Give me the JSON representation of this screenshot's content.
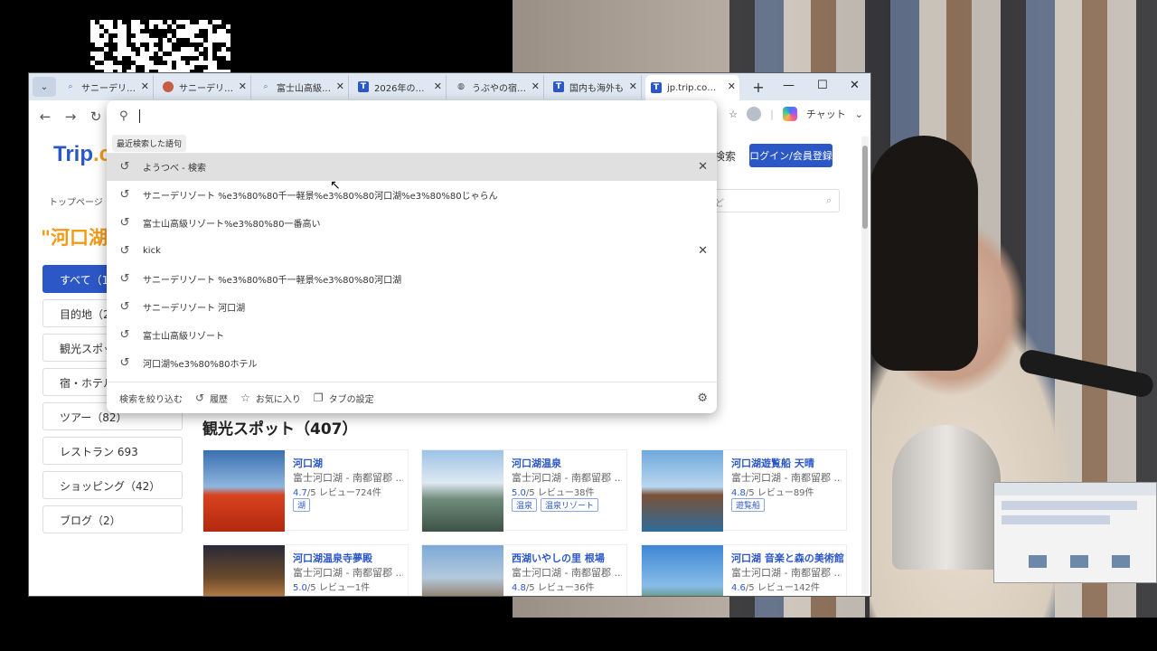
{
  "browser": {
    "tabs": [
      {
        "label": "サニーデリゾート",
        "icon": "search-icon"
      },
      {
        "label": "サニーデリゾート",
        "icon": "site-favicon-icon"
      },
      {
        "label": "富士山高級リゾ",
        "icon": "search-icon"
      },
      {
        "label": "2026年の富士山",
        "icon": "trip-favicon-icon"
      },
      {
        "label": "うぶやの宿泊予約",
        "icon": "globe-icon"
      },
      {
        "label": "国内も海外も",
        "icon": "trip-favicon-icon"
      },
      {
        "label": "jp.trip.com/glo",
        "icon": "trip-favicon-icon"
      }
    ],
    "toolbar_chat": "チャット"
  },
  "omnibox": {
    "section_header": "最近検索した語句",
    "items": [
      {
        "text": "ようつべ - 検索",
        "hover": true,
        "removable": true
      },
      {
        "text": "サニーデリゾート %e3%80%80千一軽景%e3%80%80河口湖%e3%80%80じゃらん",
        "hover": false,
        "removable": false
      },
      {
        "text": "富士山高級リゾート%e3%80%80一番高い",
        "hover": false,
        "removable": false
      },
      {
        "text": "kick",
        "hover": false,
        "removable": true
      },
      {
        "text": "サニーデリゾート %e3%80%80千一軽景%e3%80%80河口湖",
        "hover": false,
        "removable": false
      },
      {
        "text": "サニーデリゾート 河口湖",
        "hover": false,
        "removable": false
      },
      {
        "text": "富士山高級リゾート",
        "hover": false,
        "removable": false
      },
      {
        "text": "河口湖%e3%80%80ホテル",
        "hover": false,
        "removable": false
      }
    ],
    "footer": {
      "narrow": "検索を絞り込む",
      "history": "履歴",
      "favorites": "お気に入り",
      "tabs": "タブの設定"
    }
  },
  "site": {
    "logo_main": "Trip",
    "logo_dot": ".co",
    "header_search": "検索",
    "login": "ログイン/会員登録",
    "search_placeholder": "など",
    "breadcrumb": "トップページ >",
    "heading": "\"河口湖",
    "filters": [
      {
        "label": "すべて（1,",
        "active": true
      },
      {
        "label": "目的地（2",
        "active": false
      },
      {
        "label": "観光スポッ",
        "active": false
      },
      {
        "label": "宿・ホテル",
        "active": false
      },
      {
        "label": "ツアー（82）",
        "active": false
      },
      {
        "label": "レストラン 693",
        "active": false
      },
      {
        "label": "ショッピング（42）",
        "active": false
      },
      {
        "label": "ブログ（2）",
        "active": false
      }
    ],
    "section_title": "観光スポット（407）",
    "cards": [
      {
        "title": "河口湖",
        "location": "富士河口湖 - 南都留郡 ...",
        "score": "4.7",
        "rating_suffix": "/5  レビュー724件",
        "tags": [
          "湖"
        ],
        "photo": "autumn"
      },
      {
        "title": "河口湖温泉",
        "location": "富士河口湖 - 南都留郡 ...",
        "score": "5.0",
        "rating_suffix": "/5  レビュー38件",
        "tags": [
          "温泉",
          "温泉リゾート"
        ],
        "photo": "onsen"
      },
      {
        "title": "河口湖遊覧船 天晴",
        "location": "富士河口湖 - 南都留郡 ...",
        "score": "4.8",
        "rating_suffix": "/5  レビュー89件",
        "tags": [
          "遊覧船"
        ],
        "photo": "boat"
      },
      {
        "title": "河口湖温泉寺夢殿",
        "location": "富士河口湖 - 南都留郡 ...",
        "score": "5.0",
        "rating_suffix": "/5  レビュー1件",
        "tags": [],
        "photo": "temple"
      },
      {
        "title": "西湖いやしの里 根場",
        "location": "富士河口湖 - 南都留郡 ...",
        "score": "4.8",
        "rating_suffix": "/5  レビュー36件",
        "tags": [],
        "photo": "village"
      },
      {
        "title": "河口湖 音楽と森の美術館",
        "location": "富士河口湖 - 南都留郡 ...",
        "score": "4.6",
        "rating_suffix": "/5  レビュー142件",
        "tags": [],
        "photo": "museum"
      }
    ]
  },
  "colors": {
    "brand_blue": "#2c57c6",
    "brand_orange": "#f19b16"
  }
}
